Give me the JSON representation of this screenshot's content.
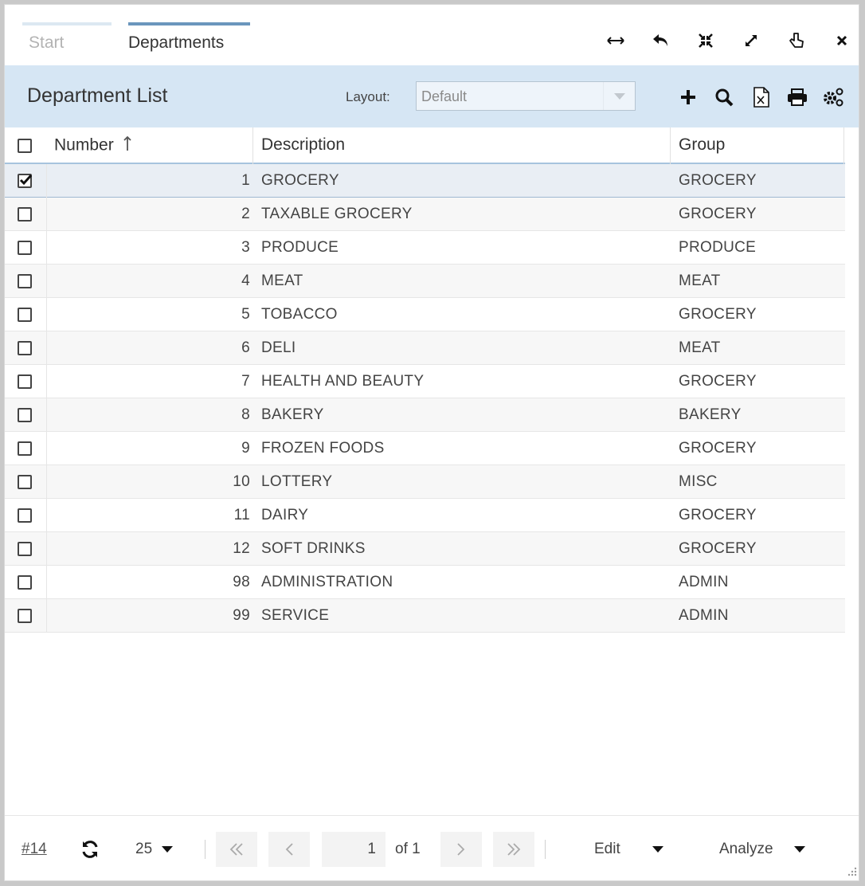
{
  "tabs": [
    {
      "label": "Start"
    },
    {
      "label": "Departments"
    }
  ],
  "header": {
    "title": "Department List",
    "layout_label": "Layout:",
    "layout_value": "Default"
  },
  "columns": {
    "number": "Number",
    "description": "Description",
    "group": "Group"
  },
  "rows": [
    {
      "number": "1",
      "description": "GROCERY",
      "group": "GROCERY",
      "checked": true
    },
    {
      "number": "2",
      "description": "TAXABLE GROCERY",
      "group": "GROCERY",
      "checked": false
    },
    {
      "number": "3",
      "description": "PRODUCE",
      "group": "PRODUCE",
      "checked": false
    },
    {
      "number": "4",
      "description": "MEAT",
      "group": "MEAT",
      "checked": false
    },
    {
      "number": "5",
      "description": "TOBACCO",
      "group": "GROCERY",
      "checked": false
    },
    {
      "number": "6",
      "description": "DELI",
      "group": "MEAT",
      "checked": false
    },
    {
      "number": "7",
      "description": "HEALTH AND BEAUTY",
      "group": "GROCERY",
      "checked": false
    },
    {
      "number": "8",
      "description": "BAKERY",
      "group": "BAKERY",
      "checked": false
    },
    {
      "number": "9",
      "description": "FROZEN FOODS",
      "group": "GROCERY",
      "checked": false
    },
    {
      "number": "10",
      "description": "LOTTERY",
      "group": "MISC",
      "checked": false
    },
    {
      "number": "11",
      "description": "DAIRY",
      "group": "GROCERY",
      "checked": false
    },
    {
      "number": "12",
      "description": "SOFT DRINKS",
      "group": "GROCERY",
      "checked": false
    },
    {
      "number": "98",
      "description": "ADMINISTRATION",
      "group": "ADMIN",
      "checked": false
    },
    {
      "number": "99",
      "description": "SERVICE",
      "group": "ADMIN",
      "checked": false
    }
  ],
  "footer": {
    "record_link": "#14",
    "page_size": "25",
    "current_page": "1",
    "of_pages": "of 1",
    "edit_label": "Edit",
    "analyze_label": "Analyze"
  },
  "icons": {
    "window_controls": [
      "resize-horizontal-icon",
      "undo-icon",
      "collapse-icon",
      "expand-icon",
      "pointer-icon",
      "close-icon"
    ],
    "toolbar": [
      "add-icon",
      "search-icon",
      "excel-export-icon",
      "print-icon",
      "settings-icon"
    ]
  },
  "colors": {
    "header_band": "#d6e6f4",
    "active_tab_bar": "#6b96bd",
    "selected_row": "#e9eef4"
  }
}
